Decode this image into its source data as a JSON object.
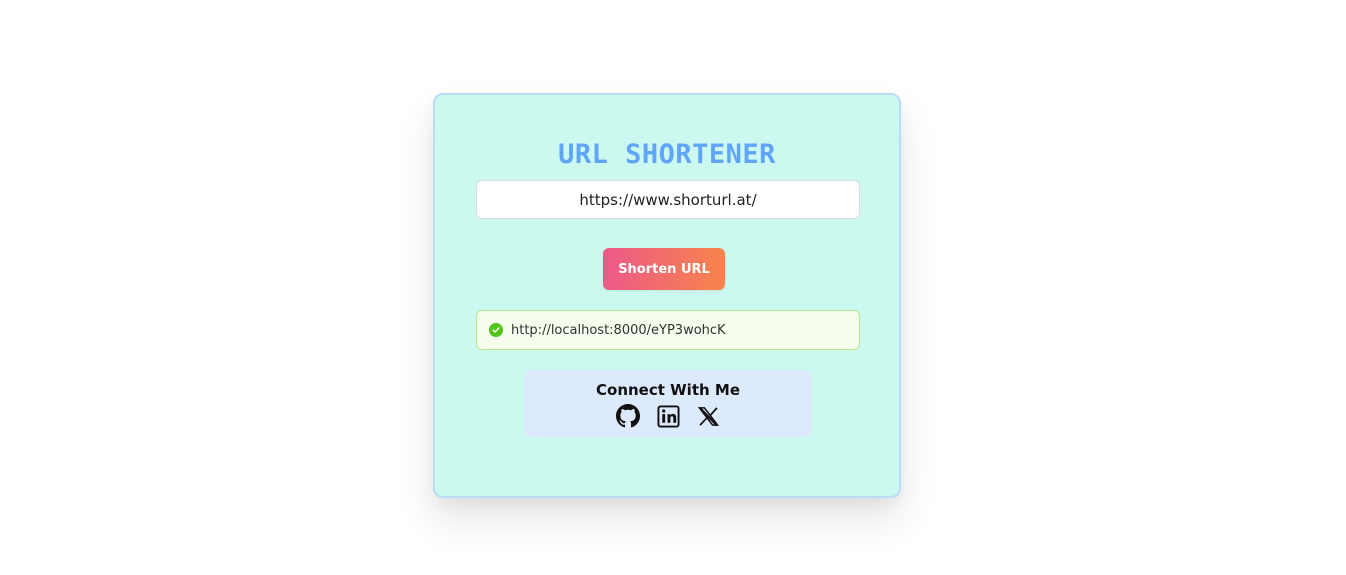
{
  "app": {
    "title": "URL SHORTENER"
  },
  "form": {
    "url_value": "https://www.shorturl.at/",
    "submit_label": "Shorten URL"
  },
  "result": {
    "status": "success",
    "status_icon": "check-circle-icon",
    "short_url": "http://localhost:8000/eYP3wohcK"
  },
  "connect": {
    "title": "Connect With Me",
    "links": [
      {
        "icon": "github-icon"
      },
      {
        "icon": "linkedin-icon"
      },
      {
        "icon": "x-twitter-icon"
      }
    ]
  },
  "colors": {
    "card_bg": "#ccf9ef",
    "title": "#60a5fa",
    "button_gradient_start": "#ec5989",
    "button_gradient_end": "#f8844a",
    "success_bg": "#f6ffed",
    "success_border": "#b7eb8f",
    "success_icon": "#52c41a",
    "connect_bg": "#dde9fd"
  }
}
